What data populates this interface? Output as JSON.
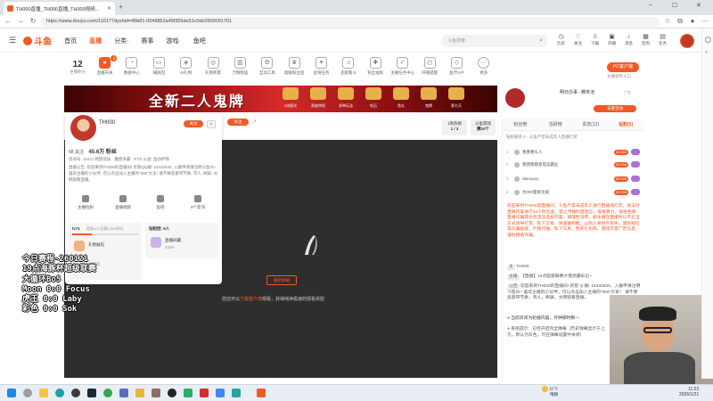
{
  "browser": {
    "tab_title": "TH000直播_TH000直播_TH000视频...",
    "url": "https://www.douyu.com/110177dyshid=45b81-0049852a49f355de51c0dc0600091701"
  },
  "header": {
    "logo_text": "斗鱼",
    "nav": [
      "首页",
      "直播",
      "分类·",
      "赛事",
      "游戏·",
      "鱼吧"
    ],
    "search_placeholder": "斗鱼搜索",
    "icons": [
      {
        "label": "历史",
        "icon": "clock-icon"
      },
      {
        "label": "关注",
        "icon": "heart-icon"
      },
      {
        "label": "下载",
        "icon": "download-icon"
      },
      {
        "label": "开播",
        "icon": "camera-icon"
      },
      {
        "label": "消息",
        "icon": "bell-icon"
      },
      {
        "label": "签到",
        "icon": "calendar-icon"
      },
      {
        "label": "任务",
        "icon": "task-icon"
      }
    ]
  },
  "toolbar": {
    "level_number": "12",
    "level_label": "主播积分",
    "items": [
      {
        "label": "直播开关",
        "icon": "live-toggle-icon",
        "badge": "2"
      },
      {
        "label": "数据中心",
        "icon": "data-center-icon"
      },
      {
        "label": "横屏回",
        "icon": "landscape-icon"
      },
      {
        "label": "AI礼物",
        "icon": "ai-icon"
      },
      {
        "label": "礼物积累",
        "icon": "gift-accumulate-icon"
      },
      {
        "label": "万物图鉴",
        "icon": "catalog-icon"
      },
      {
        "label": "互动工具",
        "icon": "tools-icon"
      },
      {
        "label": "超级粉丝团",
        "icon": "fans-icon"
      },
      {
        "label": "星海任务",
        "icon": "star-task-icon"
      },
      {
        "label": "还能看斗",
        "icon": "tiktok-icon"
      },
      {
        "label": "粉丝福利",
        "icon": "gift-icon"
      },
      {
        "label": "主播任务中心",
        "icon": "task-center-icon"
      },
      {
        "label": "开播提醒",
        "icon": "alarm-icon"
      },
      {
        "label": "鱼币VIP",
        "icon": "diamond-icon"
      },
      {
        "label": "更多",
        "icon": "more-icon"
      }
    ],
    "pc_button": "PC客户端",
    "client_label": "主播领奖入口"
  },
  "banner": {
    "title": "全新二人鬼牌",
    "gifts": [
      "2块星光",
      "贵族特权",
      "多种玩法",
      "钻石",
      "鱼丸",
      "鬼牌",
      "第七天"
    ]
  },
  "anchor_week": {
    "label": "明日办事 : 腾末池",
    "tag": "广告",
    "button": "去看活动"
  },
  "streamer_card": {
    "name": "TH000",
    "follow_label": "关注",
    "level_badge": "66",
    "follows": "68 关注",
    "fans": "45.6万 粉丝",
    "room_info": "房间号: 11017    网游竞技 · 魔兽争霸 · RTS    公会: 鱼坊萨斯",
    "intro": "直播公告: 欢迎来到TH000的直播间! 房管QQ群: 15432540, 入群申请请注明斗鱼ID~ 喜欢主播的小伙伴, 可以点击加入主播的\"000\"大军! 请不要恶意带节奏, 骂人, 刷屏, 文明观看直播。",
    "actions": [
      {
        "label": "主播拉粉",
        "icon": "pull-fans-icon"
      },
      {
        "label": "直播视频",
        "icon": "video-icon"
      },
      {
        "label": "鱼吧",
        "icon": "fishbar-icon"
      },
      {
        "label": "9个友邻",
        "icon": "friends-icon"
      }
    ],
    "fan_box_title": "lv71",
    "fan_box_sub": "距离lv72还需4,800经验",
    "gift_row": "礼物展馆",
    "gift_row2": "贡献榜",
    "right_box_title": "钻粉团: 5人",
    "right_box_row": "直播间藏",
    "right_box_sub": "4256"
  },
  "player_top": {
    "follow_label": "关注",
    "badge1_line1": "1周热榜",
    "badge1_line2": "1 / 3",
    "badge2_line1": "斗鱼游戏",
    "badge2_line2": "赛10个"
  },
  "player": {
    "refresh_button": "重新加载",
    "hint_prefix": "您还可以",
    "hint_link": "下载客户端",
    "hint_suffix": "观看，获得纯净极速的观看体验"
  },
  "osd": {
    "lines": [
      "今日赛程-260121",
      "19点海豚杯超级联赛",
      "大循环Bo5",
      "Moon 0:0 Focus",
      "虎王   0:0 Laby",
      "彩色   0:0 Sok"
    ]
  },
  "chat": {
    "tabs": [
      "粉丝榜",
      "活跃榜",
      "贵宾(12)",
      "钻粉(5)"
    ],
    "active_tab": 3,
    "subline": "钻粉服务 5  ·  斗鱼严禁未成年人直播打赏",
    "ranks": [
      {
        "n": "1",
        "name": "墨墨墨头人",
        "pill": "20 000"
      },
      {
        "n": "2",
        "name": "我我我愿意电竞霸业",
        "pill": "20 000"
      },
      {
        "n": "3",
        "name": "dannyary",
        "pill": "20 000"
      },
      {
        "n": "4",
        "name": "为000量即注册",
        "pill": "20 000"
      }
    ],
    "system_msg": "欢迎来到TH000的直播间。斗鱼严禁未成年人进行直播或打赏，依法对直播内容进行24小时巡查。禁止传播封建迷信、低俗暴力、低俗色情、直播诈骗等任何违法违规内容。请理性消费，如主播在直播时以不正当方式诱导打赏、私下交易、请谨慎判断，以防人身财产损失。谨防短信等诈骗链接，代练代抽、私下交易，购买礼包码、游戏币等广告信息，谨防网络诈骗。",
    "user_line": "TH000",
    "msg_title": "【直播】19点超级联赛大佬虎霸彩石~",
    "msg_announce": "欢迎来到TH000的直播间! 房管·Q·群: 15432540，入群申请注明斗鱼ID~ 喜欢主播的小伙伴，可以点击加入主播的\"000\"大军！ 请不要恶意带节奏，骂人，刷屏，文明观看直播。",
    "notice1": "当前房间为轮播内容，开钟随时刷～",
    "notice2": "系统提示：已经开启完全弹幕（历史弹幕显示于上方，默认为灰色，可在弹幕设置中关闭）"
  },
  "taskbar": {
    "weather_temp": "11°C",
    "weather_text": "晴朗",
    "time": "11:23",
    "date": "2026/1/21"
  }
}
